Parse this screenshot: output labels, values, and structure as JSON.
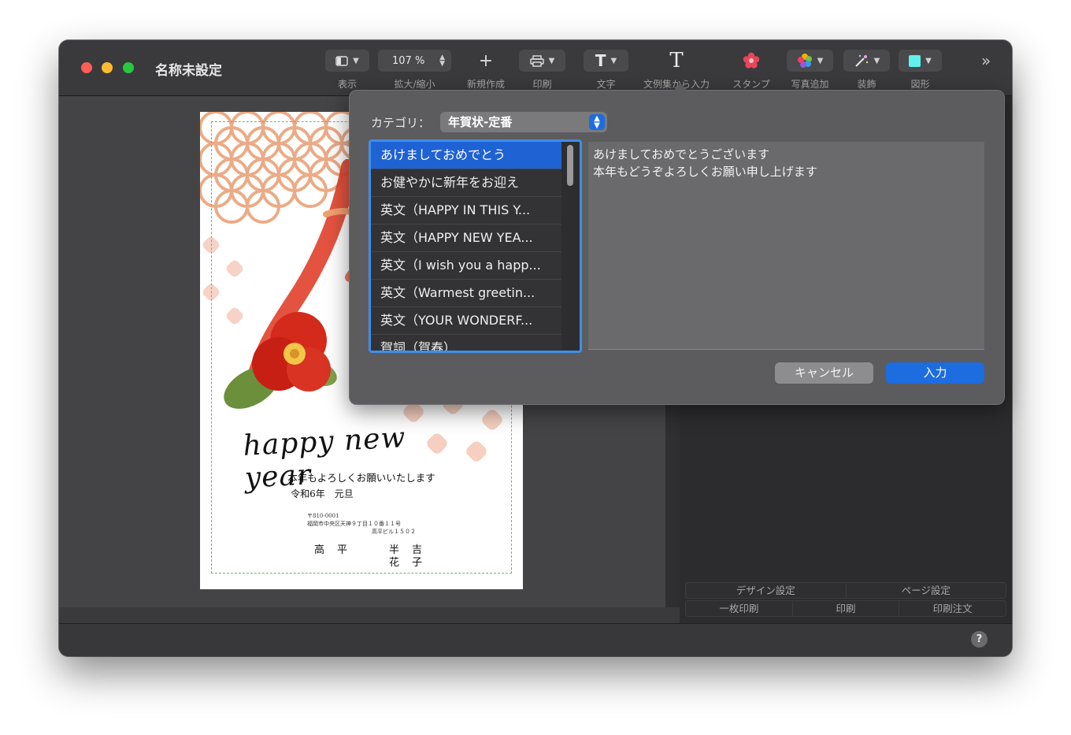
{
  "window": {
    "title": "名称未設定"
  },
  "toolbar": {
    "view_label": "表示",
    "zoom_value": "107 %",
    "zoom_label": "拡大/縮小",
    "new_label": "新規作成",
    "print_label": "印刷",
    "text_label": "文字",
    "template_text_label": "文例集から入力",
    "stamp_label": "スタンプ",
    "photo_label": "写真追加",
    "decoration_label": "装飾",
    "shape_label": "図形"
  },
  "dialog": {
    "category_label": "カテゴリ：",
    "category_value": "年賀状-定番",
    "items": [
      {
        "label": "あけましておめでとう"
      },
      {
        "label": "お健やかに新年をお迎え"
      },
      {
        "label": "英文（HAPPY IN THIS Y..."
      },
      {
        "label": "英文（HAPPY NEW YEA..."
      },
      {
        "label": "英文（I wish you a happ..."
      },
      {
        "label": "英文（Warmest greetin..."
      },
      {
        "label": "英文（YOUR WONDERF..."
      },
      {
        "label": "賀詞（賀春）"
      }
    ],
    "preview_lines": [
      "あけましておめでとうございます",
      "本年もどうぞよろしくお願い申し上げます"
    ],
    "cancel_label": "キャンセル",
    "ok_label": "入力"
  },
  "card": {
    "hny_text": "happy new year",
    "greeting": "本年もよろしくお願いいたします",
    "date": "令和6年　元旦",
    "postal": "〒810-0001",
    "address1": "福岡市中央区天神９丁目１０番１１号",
    "address2": "高平ビル１５０２",
    "surname": "高平",
    "given1": "半吉",
    "given2": "花子"
  },
  "panel": {
    "design_settings": "デザイン設定",
    "page_settings": "ページ設定",
    "single_print": "一枚印刷",
    "print": "印刷",
    "print_order": "印刷注文"
  },
  "help_label": "?",
  "colors": {
    "accent": "#1d6ce0",
    "selection": "#1f62d4",
    "window_bg": "#2f2f31"
  }
}
